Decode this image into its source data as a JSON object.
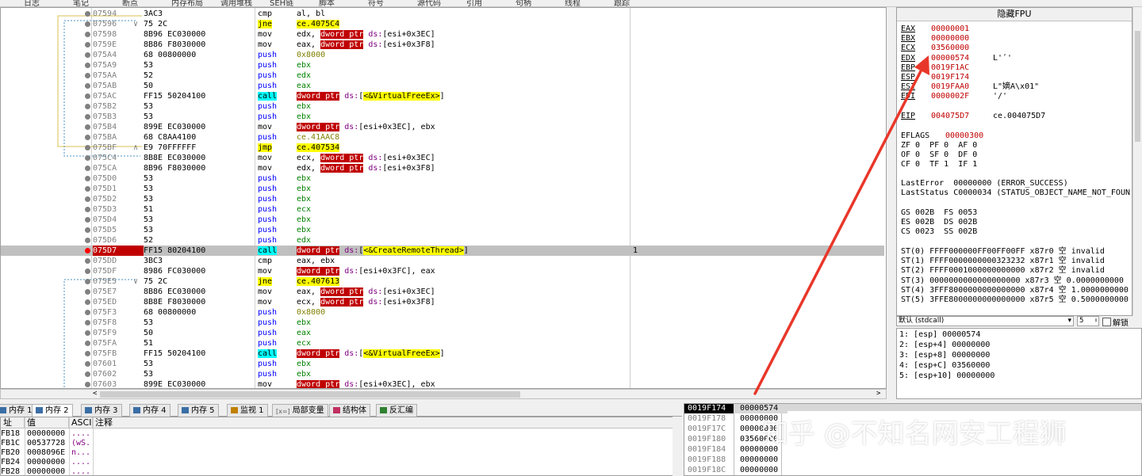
{
  "top_tabs": [
    "日志",
    "笔记",
    "断点",
    "内存布局",
    "调用堆栈",
    "SEH链",
    "脚本",
    "符号",
    "源代码",
    "引用",
    "句柄",
    "线程",
    "跟踪"
  ],
  "disasm": {
    "rows": [
      {
        "addr": "07594",
        "bytes": "3AC3",
        "mn": "cmp",
        "ops": [
          {
            "t": "al, bl"
          }
        ]
      },
      {
        "addr": "07596",
        "bytes": "75 2C",
        "mn": "jne",
        "mn_hl": "y",
        "ops": [
          {
            "t": "ce.4075C4",
            "c": "y"
          }
        ],
        "arrow": "v"
      },
      {
        "addr": "07598",
        "bytes": "8B96 EC030000",
        "mn": "mov",
        "ops": [
          {
            "t": "edx, "
          },
          {
            "t": "dword ptr",
            "c": "r"
          },
          {
            "t": " ds:",
            "c": "purple"
          },
          {
            "t": "[esi+0x3EC]"
          }
        ]
      },
      {
        "addr": "0759E",
        "bytes": "8B86 F8030000",
        "mn": "mov",
        "ops": [
          {
            "t": "eax, "
          },
          {
            "t": "dword ptr",
            "c": "r"
          },
          {
            "t": " ds:",
            "c": "purple"
          },
          {
            "t": "[esi+0x3F8]"
          }
        ]
      },
      {
        "addr": "075A4",
        "bytes": "68 00800000",
        "mn": "push",
        "mn_blue": true,
        "ops": [
          {
            "t": "0x8000",
            "c": "olive"
          }
        ]
      },
      {
        "addr": "075A9",
        "bytes": "53",
        "mn": "push",
        "mn_blue": true,
        "ops": [
          {
            "t": "ebx",
            "c": "green"
          }
        ]
      },
      {
        "addr": "075AA",
        "bytes": "52",
        "mn": "push",
        "mn_blue": true,
        "ops": [
          {
            "t": "edx",
            "c": "green"
          }
        ]
      },
      {
        "addr": "075AB",
        "bytes": "50",
        "mn": "push",
        "mn_blue": true,
        "ops": [
          {
            "t": "eax",
            "c": "green"
          }
        ]
      },
      {
        "addr": "075AC",
        "bytes": "FF15 50204100",
        "mn": "call",
        "mn_hl": "c",
        "ops": [
          {
            "t": "dword ptr",
            "c": "r"
          },
          {
            "t": " ds:",
            "c": "purple"
          },
          {
            "t": "[",
            "c": null
          },
          {
            "t": "<&VirtualFreeEx>",
            "c": "y"
          },
          {
            "t": "]"
          }
        ]
      },
      {
        "addr": "075B2",
        "bytes": "53",
        "mn": "push",
        "mn_blue": true,
        "ops": [
          {
            "t": "ebx",
            "c": "green"
          }
        ]
      },
      {
        "addr": "075B3",
        "bytes": "53",
        "mn": "push",
        "mn_blue": true,
        "ops": [
          {
            "t": "ebx",
            "c": "green"
          }
        ]
      },
      {
        "addr": "075B4",
        "bytes": "899E EC030000",
        "mn": "mov",
        "ops": [
          {
            "t": "dword ptr",
            "c": "r"
          },
          {
            "t": " ds:",
            "c": "purple"
          },
          {
            "t": "[esi+0x3EC], ebx"
          }
        ]
      },
      {
        "addr": "075BA",
        "bytes": "68 C8AA4100",
        "mn": "push",
        "mn_blue": true,
        "ops": [
          {
            "t": "ce.41AAC8",
            "c": "olive"
          }
        ]
      },
      {
        "addr": "075BF",
        "bytes": "E9 70FFFFFF",
        "mn": "jmp",
        "mn_hl": "y",
        "ops": [
          {
            "t": "ce.407534",
            "c": "y"
          }
        ],
        "arrow": "up"
      },
      {
        "addr": "075C4",
        "bytes": "8B8E EC030000",
        "mn": "mov",
        "ops": [
          {
            "t": "ecx, "
          },
          {
            "t": "dword ptr",
            "c": "r"
          },
          {
            "t": " ds:",
            "c": "purple"
          },
          {
            "t": "[esi+0x3EC]"
          }
        ]
      },
      {
        "addr": "075CA",
        "bytes": "8B96 F8030000",
        "mn": "mov",
        "ops": [
          {
            "t": "edx, "
          },
          {
            "t": "dword ptr",
            "c": "r"
          },
          {
            "t": " ds:",
            "c": "purple"
          },
          {
            "t": "[esi+0x3F8]"
          }
        ]
      },
      {
        "addr": "075D0",
        "bytes": "53",
        "mn": "push",
        "mn_blue": true,
        "ops": [
          {
            "t": "ebx",
            "c": "green"
          }
        ]
      },
      {
        "addr": "075D1",
        "bytes": "53",
        "mn": "push",
        "mn_blue": true,
        "ops": [
          {
            "t": "ebx",
            "c": "green"
          }
        ]
      },
      {
        "addr": "075D2",
        "bytes": "53",
        "mn": "push",
        "mn_blue": true,
        "ops": [
          {
            "t": "ebx",
            "c": "green"
          }
        ]
      },
      {
        "addr": "075D3",
        "bytes": "51",
        "mn": "push",
        "mn_blue": true,
        "ops": [
          {
            "t": "ecx",
            "c": "green"
          }
        ]
      },
      {
        "addr": "075D4",
        "bytes": "53",
        "mn": "push",
        "mn_blue": true,
        "ops": [
          {
            "t": "ebx",
            "c": "green"
          }
        ]
      },
      {
        "addr": "075D5",
        "bytes": "53",
        "mn": "push",
        "mn_blue": true,
        "ops": [
          {
            "t": "ebx",
            "c": "green"
          }
        ]
      },
      {
        "addr": "075D6",
        "bytes": "52",
        "mn": "push",
        "mn_blue": true,
        "ops": [
          {
            "t": "edx",
            "c": "green"
          }
        ]
      },
      {
        "addr": "075D7",
        "bytes": "FF15 80204100",
        "mn": "call",
        "mn_hl": "c",
        "sel": true,
        "cur": true,
        "comment": "1",
        "ops": [
          {
            "t": "dword ptr",
            "c": "r"
          },
          {
            "t": " ds:",
            "c": "purple"
          },
          {
            "t": "[",
            "c": null
          },
          {
            "t": "<&CreateRemoteThread>",
            "c": "y"
          },
          {
            "t": "]"
          }
        ]
      },
      {
        "addr": "075DD",
        "bytes": "3BC3",
        "mn": "cmp",
        "ops": [
          {
            "t": "eax, ebx"
          }
        ]
      },
      {
        "addr": "075DF",
        "bytes": "8986 FC030000",
        "mn": "mov",
        "ops": [
          {
            "t": "dword ptr",
            "c": "r"
          },
          {
            "t": " ds:",
            "c": "purple"
          },
          {
            "t": "[esi+0x3FC], eax"
          }
        ]
      },
      {
        "addr": "075E5",
        "bytes": "75 2C",
        "mn": "jne",
        "mn_hl": "y",
        "ops": [
          {
            "t": "ce.407613",
            "c": "y"
          }
        ],
        "arrow": "v"
      },
      {
        "addr": "075E7",
        "bytes": "8B86 EC030000",
        "mn": "mov",
        "ops": [
          {
            "t": "eax, "
          },
          {
            "t": "dword ptr",
            "c": "r"
          },
          {
            "t": " ds:",
            "c": "purple"
          },
          {
            "t": "[esi+0x3EC]"
          }
        ]
      },
      {
        "addr": "075ED",
        "bytes": "8B8E F8030000",
        "mn": "mov",
        "ops": [
          {
            "t": "ecx, "
          },
          {
            "t": "dword ptr",
            "c": "r"
          },
          {
            "t": " ds:",
            "c": "purple"
          },
          {
            "t": "[esi+0x3F8]"
          }
        ]
      },
      {
        "addr": "075F3",
        "bytes": "68 00800000",
        "mn": "push",
        "mn_blue": true,
        "ops": [
          {
            "t": "0x8000",
            "c": "olive"
          }
        ]
      },
      {
        "addr": "075F8",
        "bytes": "53",
        "mn": "push",
        "mn_blue": true,
        "ops": [
          {
            "t": "ebx",
            "c": "green"
          }
        ]
      },
      {
        "addr": "075F9",
        "bytes": "50",
        "mn": "push",
        "mn_blue": true,
        "ops": [
          {
            "t": "eax",
            "c": "green"
          }
        ]
      },
      {
        "addr": "075FA",
        "bytes": "51",
        "mn": "push",
        "mn_blue": true,
        "ops": [
          {
            "t": "ecx",
            "c": "green"
          }
        ]
      },
      {
        "addr": "075FB",
        "bytes": "FF15 50204100",
        "mn": "call",
        "mn_hl": "c",
        "ops": [
          {
            "t": "dword ptr",
            "c": "r"
          },
          {
            "t": " ds:",
            "c": "purple"
          },
          {
            "t": "[",
            "c": null
          },
          {
            "t": "<&VirtualFreeEx>",
            "c": "y"
          },
          {
            "t": "]"
          }
        ]
      },
      {
        "addr": "07601",
        "bytes": "53",
        "mn": "push",
        "mn_blue": true,
        "ops": [
          {
            "t": "ebx",
            "c": "green"
          }
        ]
      },
      {
        "addr": "07602",
        "bytes": "53",
        "mn": "push",
        "mn_blue": true,
        "ops": [
          {
            "t": "ebx",
            "c": "green"
          }
        ]
      },
      {
        "addr": "07603",
        "bytes": "899E EC030000",
        "mn": "mov",
        "ops": [
          {
            "t": "dword ptr",
            "c": "r"
          },
          {
            "t": " ds:",
            "c": "purple"
          },
          {
            "t": "[esi+0x3EC], ebx"
          }
        ]
      }
    ],
    "scroll_left": "<",
    "scroll_right": ">"
  },
  "registers": {
    "title": "隐藏FPU",
    "gp": [
      {
        "name": "EAX",
        "value": "00000001",
        "comment": ""
      },
      {
        "name": "EBX",
        "value": "00000000",
        "comment": ""
      },
      {
        "name": "ECX",
        "value": "03560000",
        "comment": ""
      },
      {
        "name": "EDX",
        "value": "00000574",
        "comment": "L'ʹ'"
      },
      {
        "name": "EBP",
        "value": "0019F1AC",
        "comment": ""
      },
      {
        "name": "ESP",
        "value": "0019F174",
        "comment": ""
      },
      {
        "name": "ESI",
        "value": "0019FAA0",
        "comment": "L\"嫡A\\x01\""
      },
      {
        "name": "EDI",
        "value": "0000002F",
        "comment": "'/'"
      }
    ],
    "eip": {
      "name": "EIP",
      "value": "004075D7",
      "comment": "ce.004075D7"
    },
    "eflags": {
      "name": "EFLAGS",
      "value": "00000300"
    },
    "flags": [
      "ZF 0  PF 0  AF 0",
      "OF 0  SF 0  DF 0",
      "CF 0  TF 1  IF 1"
    ],
    "last_error": "LastError  00000000 (ERROR_SUCCESS)",
    "last_status": "LastStatus C0000034 (STATUS_OBJECT_NAME_NOT_FOUN",
    "segments": [
      "GS 002B  FS 0053",
      "ES 002B  DS 002B",
      "CS 0023  SS 002B"
    ],
    "fpu": [
      "ST(0) FFFF000000FF00FF00FF x87r0 空 invalid",
      "ST(1) FFFF0000000000323232 x87r1 空 invalid",
      "ST(2) FFFF0001000000000000 x87r2 空 invalid",
      "ST(3) 0000000000000000000 x87r3 空 0.0000000000",
      "ST(4) 3FFF8000000000000000 x87r4 空 1.0000000000",
      "ST(5) 3FFE8000000000000000 x87r5 空 0.5000000000"
    ]
  },
  "callconv": {
    "selected": "默认 (stdcall)",
    "count": "5",
    "unlock_label": "解锁"
  },
  "args": [
    "1: [esp] 00000574",
    "2: [esp+4] 00000000",
    "3: [esp+8] 00000000",
    "4: [esp+C] 03560000",
    "5: [esp+10] 00000000"
  ],
  "bottom_tabs": [
    {
      "label": "内存 1",
      "icon_color": "#3a6ea5"
    },
    {
      "label": "内存 2",
      "icon_color": "#3a6ea5",
      "active": true
    },
    {
      "label": "内存 3",
      "icon_color": "#3a6ea5"
    },
    {
      "label": "内存 4",
      "icon_color": "#3a6ea5"
    },
    {
      "label": "内存 5",
      "icon_color": "#3a6ea5"
    },
    {
      "label": "监视 1",
      "icon_color": "#c08000"
    },
    {
      "label": "局部变量",
      "icon_color": "#909090",
      "prefix": "[x=]"
    },
    {
      "label": "结构体",
      "icon_color": "#c03060"
    },
    {
      "label": "反汇编",
      "icon_color": "#308030"
    }
  ],
  "mem": {
    "headers": [
      "址",
      "值",
      "ASCI",
      "注释"
    ],
    "rows": [
      {
        "addr": "FB18",
        "val": "00000000",
        "ascii": "...."
      },
      {
        "addr": "FB1C",
        "val": "00537728",
        "ascii": "(wS."
      },
      {
        "addr": "FB20",
        "val": "0008096E",
        "ascii": "n..."
      },
      {
        "addr": "FB24",
        "val": "00000000",
        "ascii": "...."
      },
      {
        "addr": "FB28",
        "val": "00000000",
        "ascii": "...."
      }
    ]
  },
  "stack": {
    "rows": [
      {
        "addr": "0019F174",
        "val": "00000574",
        "cur": true
      },
      {
        "addr": "0019F178",
        "val": "00000000"
      },
      {
        "addr": "0019F17C",
        "val": "00000000"
      },
      {
        "addr": "0019F180",
        "val": "03560000"
      },
      {
        "addr": "0019F184",
        "val": "00000000"
      },
      {
        "addr": "0019F188",
        "val": "00000000"
      },
      {
        "addr": "0019F18C",
        "val": "00000000"
      }
    ]
  },
  "watermark": "知乎 @不知名网安工程狮",
  "colors": {
    "annotation_arrow": "#e8372a",
    "yellow": "#ffff00",
    "cyan": "#00ffff",
    "darkred": "#c00000"
  }
}
